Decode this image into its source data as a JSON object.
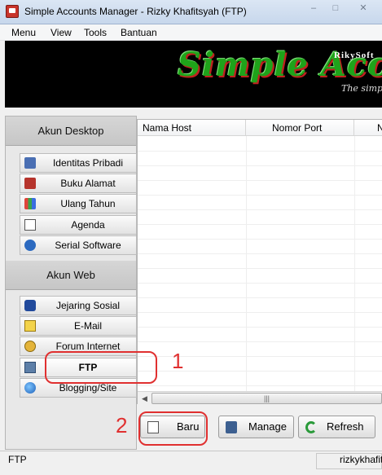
{
  "window": {
    "title": "Simple Accounts Manager - Rizky Khafitsyah (FTP)",
    "min_glyph": "–",
    "max_glyph": "□",
    "close_glyph": "✕"
  },
  "menubar": [
    "Menu",
    "View",
    "Tools",
    "Bantuan"
  ],
  "banner": {
    "brand": "RikySoft",
    "script_title": "Simple Accounts",
    "tagline": "The simple"
  },
  "left_panel": {
    "desktop_header": "Akun Desktop",
    "desktop_items": [
      {
        "label": "Identitas Pribadi",
        "icon": "id-card-icon"
      },
      {
        "label": "Buku Alamat",
        "icon": "address-book-icon"
      },
      {
        "label": "Ulang Tahun",
        "icon": "birthday-icon"
      },
      {
        "label": "Agenda",
        "icon": "agenda-icon"
      },
      {
        "label": "Serial Software",
        "icon": "serial-icon"
      }
    ],
    "web_header": "Akun Web",
    "web_items": [
      {
        "label": "Jejaring Sosial",
        "icon": "social-icon"
      },
      {
        "label": "E-Mail",
        "icon": "mail-icon"
      },
      {
        "label": "Forum Internet",
        "icon": "forum-icon"
      },
      {
        "label": "FTP",
        "icon": "ftp-icon"
      },
      {
        "label": "Blogging/Site",
        "icon": "globe-icon"
      }
    ]
  },
  "table": {
    "columns": [
      "Nama Host",
      "Nomor Port",
      "N"
    ],
    "rows": []
  },
  "scrollbar": {
    "left": "◀",
    "right": "▶",
    "grip": "|||"
  },
  "actions": {
    "new_label": "Baru",
    "manage_label": "Manage",
    "refresh_label": "Refresh"
  },
  "status": {
    "left": "FTP",
    "right": "rizkykhafit"
  },
  "annotations": {
    "one": "1",
    "two": "2",
    "color": "#e03030"
  }
}
